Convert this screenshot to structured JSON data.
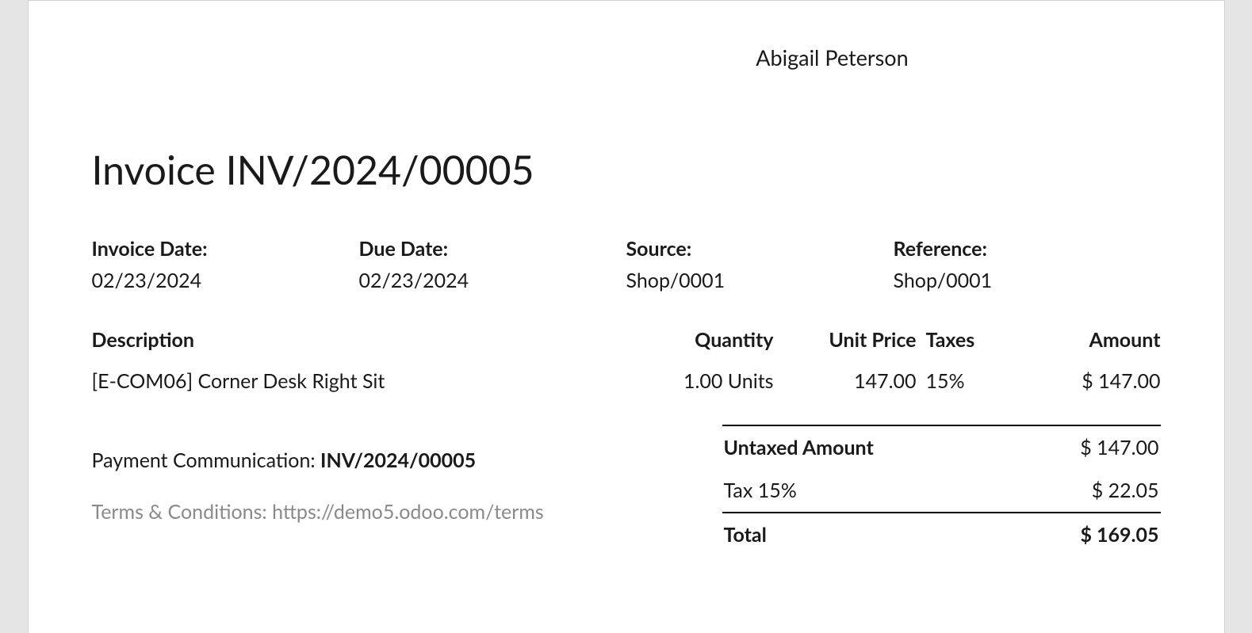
{
  "customer_name": "Abigail Peterson",
  "invoice_title": "Invoice INV/2024/00005",
  "meta": {
    "invoice_date_label": "Invoice Date:",
    "invoice_date_value": "02/23/2024",
    "due_date_label": "Due Date:",
    "due_date_value": "02/23/2024",
    "source_label": "Source:",
    "source_value": "Shop/0001",
    "reference_label": "Reference:",
    "reference_value": "Shop/0001"
  },
  "columns": {
    "description": "Description",
    "quantity": "Quantity",
    "unit_price": "Unit Price",
    "taxes": "Taxes",
    "amount": "Amount"
  },
  "line": {
    "description": "[E-COM06] Corner Desk Right Sit",
    "quantity": "1.00 Units",
    "unit_price": "147.00",
    "taxes": "15%",
    "amount": "$ 147.00"
  },
  "payment_communication": {
    "label": "Payment Communication: ",
    "value": "INV/2024/00005"
  },
  "terms_text": "Terms & Conditions: https://demo5.odoo.com/terms",
  "totals": {
    "untaxed_label": "Untaxed Amount",
    "untaxed_value": "$ 147.00",
    "tax_label": "Tax 15%",
    "tax_value": "$ 22.05",
    "total_label": "Total",
    "total_value": "$ 169.05"
  }
}
